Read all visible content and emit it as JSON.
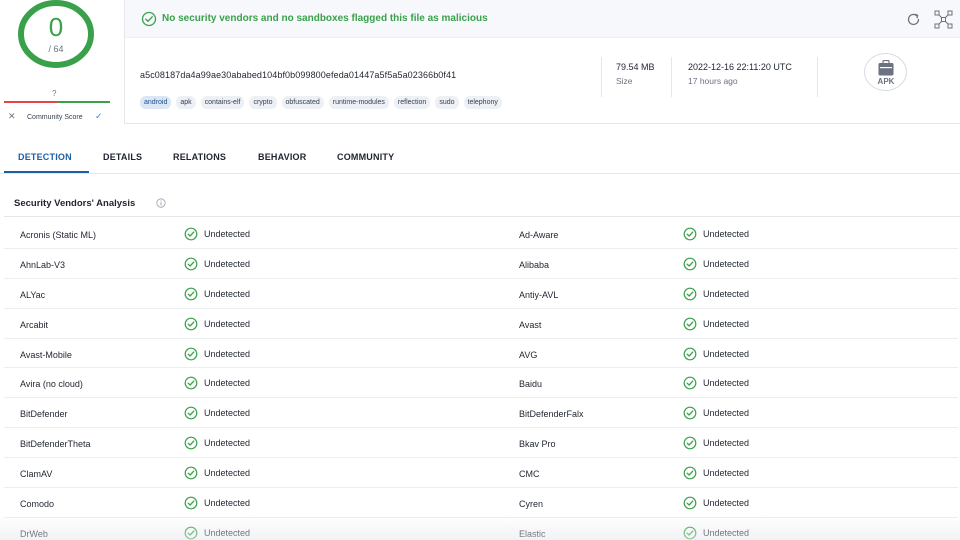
{
  "score": {
    "detections": "0",
    "total": "/ 64",
    "ring_color": "#3aa14b"
  },
  "community": {
    "value": "?",
    "label": "Community Score"
  },
  "banner": {
    "text": "No security vendors and no sandboxes flagged this file as malicious",
    "color": "#3aa14b"
  },
  "file": {
    "hash": "a5c08187da4a99ae30ababed104bf0b099800efeda01447a5f5a5a02366b0f41",
    "tags": [
      "android",
      "apk",
      "contains-elf",
      "crypto",
      "obfuscated",
      "runtime-modules",
      "reflection",
      "sudo",
      "telephony"
    ],
    "size_value": "79.54 MB",
    "size_label": "Size",
    "date_value": "2022-12-16 22:11:20 UTC",
    "date_relative": "17 hours ago",
    "type_label": "APK"
  },
  "tabs": [
    {
      "label": "DETECTION",
      "active": true
    },
    {
      "label": "DETAILS",
      "active": false
    },
    {
      "label": "RELATIONS",
      "active": false
    },
    {
      "label": "BEHAVIOR",
      "active": false
    },
    {
      "label": "COMMUNITY",
      "active": false
    }
  ],
  "section": {
    "title": "Security Vendors' Analysis"
  },
  "vendors": [
    [
      {
        "name": "Acronis (Static ML)",
        "result": "Undetected"
      },
      {
        "name": "Ad-Aware",
        "result": "Undetected"
      }
    ],
    [
      {
        "name": "AhnLab-V3",
        "result": "Undetected"
      },
      {
        "name": "Alibaba",
        "result": "Undetected"
      }
    ],
    [
      {
        "name": "ALYac",
        "result": "Undetected"
      },
      {
        "name": "Antiy-AVL",
        "result": "Undetected"
      }
    ],
    [
      {
        "name": "Arcabit",
        "result": "Undetected"
      },
      {
        "name": "Avast",
        "result": "Undetected"
      }
    ],
    [
      {
        "name": "Avast-Mobile",
        "result": "Undetected"
      },
      {
        "name": "AVG",
        "result": "Undetected"
      }
    ],
    [
      {
        "name": "Avira (no cloud)",
        "result": "Undetected"
      },
      {
        "name": "Baidu",
        "result": "Undetected"
      }
    ],
    [
      {
        "name": "BitDefender",
        "result": "Undetected"
      },
      {
        "name": "BitDefenderFalx",
        "result": "Undetected"
      }
    ],
    [
      {
        "name": "BitDefenderTheta",
        "result": "Undetected"
      },
      {
        "name": "Bkav Pro",
        "result": "Undetected"
      }
    ],
    [
      {
        "name": "ClamAV",
        "result": "Undetected"
      },
      {
        "name": "CMC",
        "result": "Undetected"
      }
    ],
    [
      {
        "name": "Comodo",
        "result": "Undetected"
      },
      {
        "name": "Cyren",
        "result": "Undetected"
      }
    ],
    [
      {
        "name": "DrWeb",
        "result": "Undetected"
      },
      {
        "name": "Elastic",
        "result": "Undetected"
      }
    ]
  ],
  "colors": {
    "accent": "#1d5fa6",
    "ok": "#3aa14b",
    "community_bad": "#e64545"
  }
}
